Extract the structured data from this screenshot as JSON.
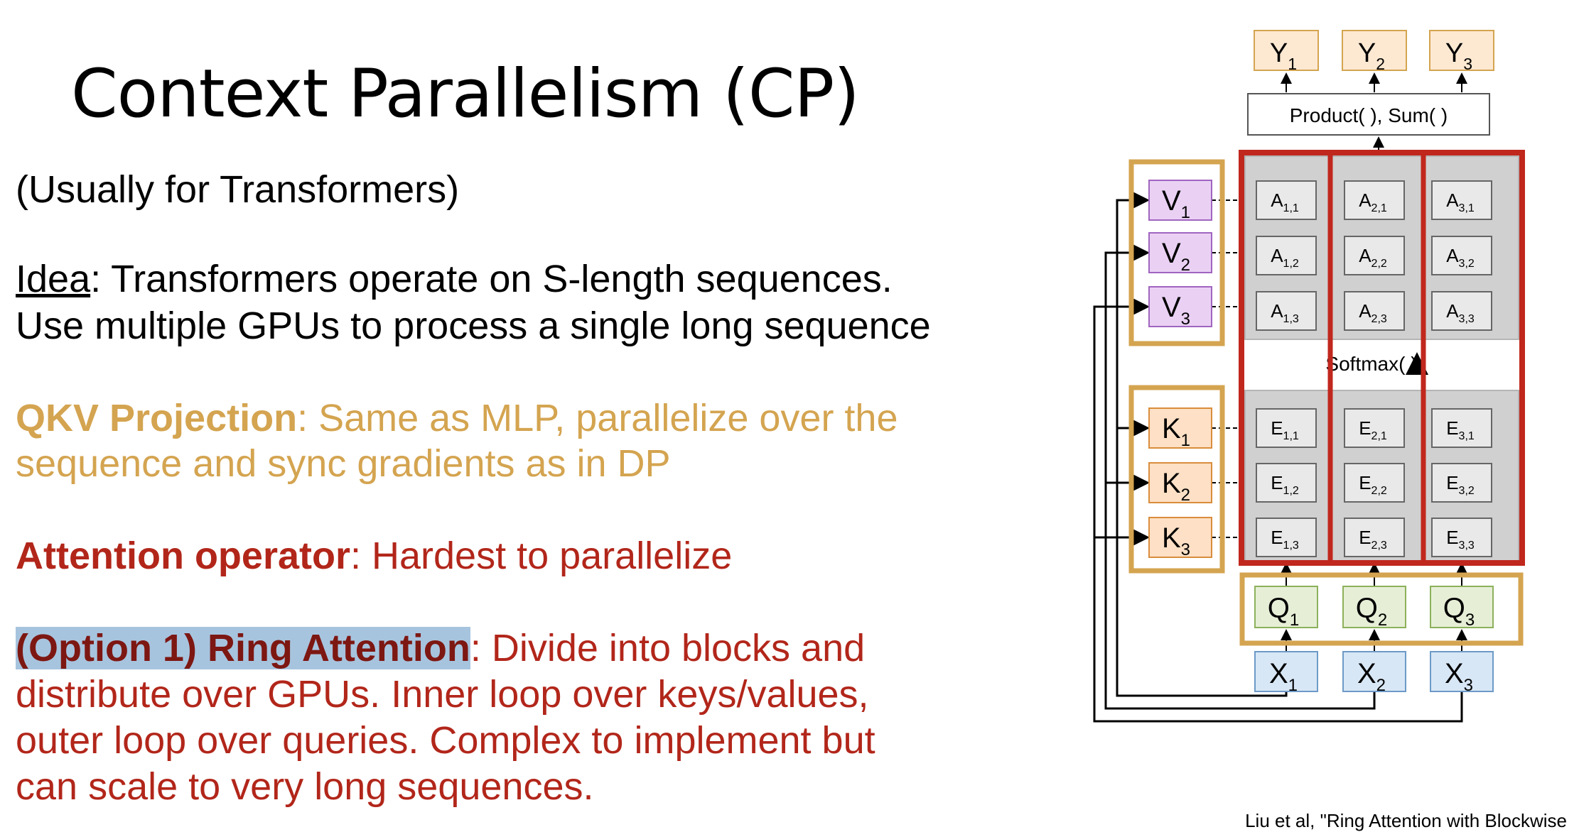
{
  "title": "Context Parallelism (CP)",
  "subtitle": "(Usually for Transformers)",
  "idea": {
    "label": "Idea",
    "line1": ": Transformers operate on S-length sequences.",
    "line2": "Use multiple GPUs to process a single long sequence"
  },
  "qkv": {
    "label": "QKV Projection",
    "line1": ": Same as MLP, parallelize over the",
    "line2": "sequence and sync gradients as in DP"
  },
  "attention": {
    "label": "Attention operator",
    "text": ": Hardest to parallelize"
  },
  "ring": {
    "label": "(Option 1) Ring Attention",
    "line1": ": Divide into blocks and",
    "line2": "distribute over GPUs. Inner loop over keys/values,",
    "line3": "outer loop over queries. Complex to implement but",
    "line4": "can scale to very long sequences."
  },
  "diagram": {
    "y_labels": [
      "Y",
      "Y",
      "Y"
    ],
    "y_subs": [
      "1",
      "2",
      "3"
    ],
    "product_label": "Product(   ), Sum(   )",
    "v_labels": [
      "V",
      "V",
      "V"
    ],
    "k_labels": [
      "K",
      "K",
      "K"
    ],
    "q_labels": [
      "Q",
      "Q",
      "Q"
    ],
    "x_labels": [
      "X",
      "X",
      "X"
    ],
    "subs": [
      "1",
      "2",
      "3"
    ],
    "a_cells": [
      [
        "A1,1",
        "A2,1",
        "A3,1"
      ],
      [
        "A1,2",
        "A2,2",
        "A3,2"
      ],
      [
        "A1,3",
        "A2,3",
        "A3,3"
      ]
    ],
    "e_cells": [
      [
        "E1,1",
        "E2,1",
        "E3,1"
      ],
      [
        "E1,2",
        "E2,2",
        "E3,2"
      ],
      [
        "E1,3",
        "E2,3",
        "E3,3"
      ]
    ],
    "softmax_label": "Softmax(   )",
    "colors": {
      "y_fill": "#fde9d2",
      "y_stroke": "#d4a450",
      "v_fill": "#ead1f4",
      "v_stroke": "#a065c0",
      "k_fill": "#fde0c5",
      "k_stroke": "#d98d3c",
      "q_fill": "#e6efd6",
      "q_stroke": "#8db15c",
      "x_fill": "#d8e7f6",
      "x_stroke": "#6d9ac7",
      "gold": "#d4a450",
      "red": "#c0271d",
      "grid": "#d0d0d0"
    }
  },
  "citation": "Liu et al, \"Ring Attention with Blockwise"
}
